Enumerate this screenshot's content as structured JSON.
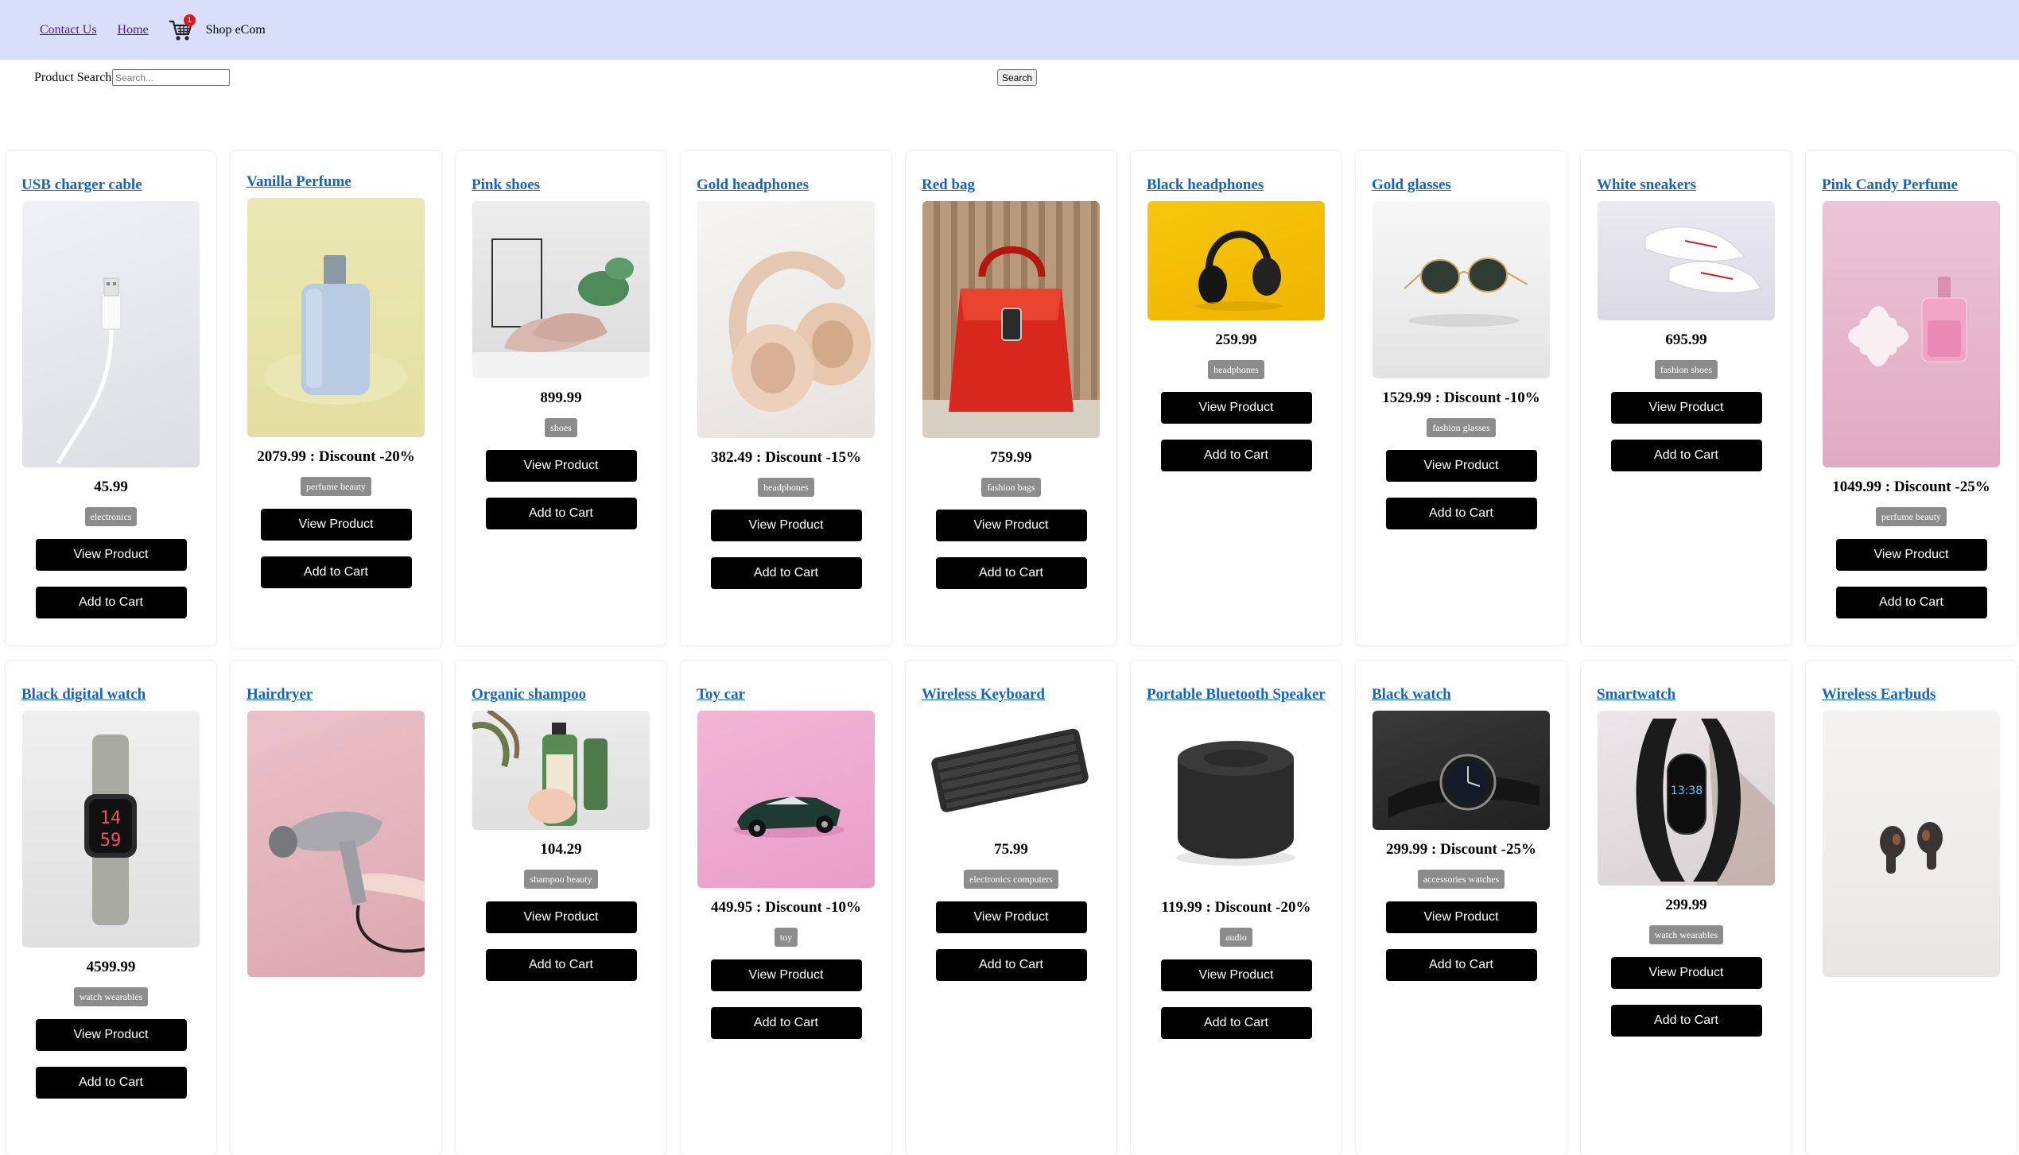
{
  "nav": {
    "contact_label": "Contact Us",
    "home_label": "Home",
    "cart_count": "1",
    "brand": "Shop eCom"
  },
  "search": {
    "label": "Product Search",
    "placeholder": "Search...",
    "button_label": "Search"
  },
  "buttons": {
    "view": "View Product",
    "add": "Add to Cart"
  },
  "products": [
    {
      "name": "USB charger cable",
      "price": "45.99",
      "category": "electronics"
    },
    {
      "name": "Vanilla Perfume",
      "price": "2079.99 : Discount -20%",
      "category": "perfume beauty"
    },
    {
      "name": "Pink shoes",
      "price": "899.99",
      "category": "shoes"
    },
    {
      "name": "Gold headphones",
      "price": "382.49 : Discount -15%",
      "category": "headphones"
    },
    {
      "name": "Red bag",
      "price": "759.99",
      "category": "fashion bags"
    },
    {
      "name": "Black headphones",
      "price": "259.99",
      "category": "headphones"
    },
    {
      "name": "Gold glasses",
      "price": "1529.99 : Discount -10%",
      "category": "fashion glasses"
    },
    {
      "name": "White sneakers",
      "price": "695.99",
      "category": "fashion shoes"
    },
    {
      "name": "Pink Candy Perfume",
      "price": "1049.99 : Discount -25%",
      "category": "perfume beauty"
    },
    {
      "name": "Black digital watch",
      "price": "4599.99",
      "category": "watch wearables"
    },
    {
      "name": "Hairdryer",
      "price": "",
      "category": ""
    },
    {
      "name": "Organic shampoo",
      "price": "104.29",
      "category": "shampoo beauty"
    },
    {
      "name": "Toy car",
      "price": "449.95 : Discount -10%",
      "category": "toy"
    },
    {
      "name": "Wireless Keyboard",
      "price": "75.99",
      "category": "electronics computers"
    },
    {
      "name": "Portable Bluetooth Speaker",
      "price": "119.99 : Discount -20%",
      "category": "audio"
    },
    {
      "name": "Black watch",
      "price": "299.99 : Discount -25%",
      "category": "accessories watches"
    },
    {
      "name": "Smartwatch",
      "price": "299.99",
      "category": "watch wearables"
    },
    {
      "name": "Wireless Earbuds",
      "price": "",
      "category": ""
    }
  ]
}
